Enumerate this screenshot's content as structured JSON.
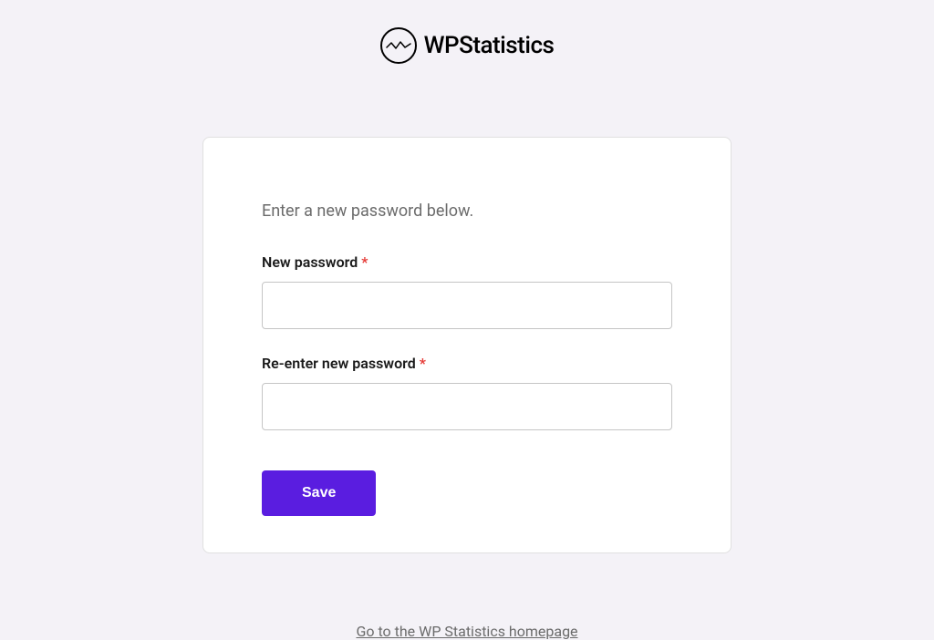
{
  "logo": {
    "text": "WPStatistics"
  },
  "form": {
    "instruction": "Enter a new password below.",
    "new_password_label": "New password",
    "reenter_password_label": "Re-enter new password",
    "required_marker": "*",
    "save_label": "Save"
  },
  "footer": {
    "homepage_link": "Go to the WP Statistics homepage"
  }
}
